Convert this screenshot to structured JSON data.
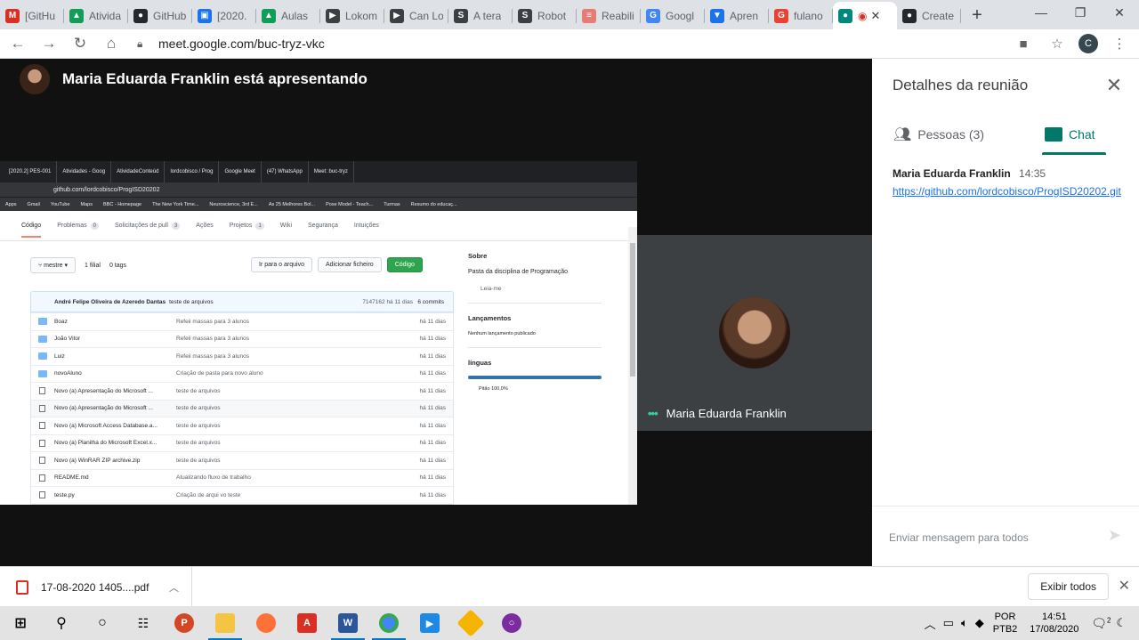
{
  "browser": {
    "tabs": [
      {
        "label": "[GitHu",
        "icon": "gmail-icon",
        "color": "#d93025",
        "glyph": "M"
      },
      {
        "label": "Ativida",
        "icon": "drive-icon",
        "color": "#0f9d58",
        "glyph": "▲"
      },
      {
        "label": "GitHub",
        "icon": "github-icon",
        "color": "#24292e",
        "glyph": "●"
      },
      {
        "label": "[2020.",
        "icon": "classroom-icon",
        "color": "#1a73e8",
        "glyph": "▣"
      },
      {
        "label": "Aulas",
        "icon": "drive-icon",
        "color": "#0f9d58",
        "glyph": "▲"
      },
      {
        "label": "Lokom",
        "icon": "bookmark-icon",
        "color": "#3c4043",
        "glyph": "▶"
      },
      {
        "label": "Can Lo",
        "icon": "bookmark-icon",
        "color": "#3c4043",
        "glyph": "▶"
      },
      {
        "label": "A tera",
        "icon": "scholar-icon",
        "color": "#3c4043",
        "glyph": "S"
      },
      {
        "label": "Robot",
        "icon": "scholar-icon",
        "color": "#3c4043",
        "glyph": "S"
      },
      {
        "label": "Reabili",
        "icon": "site-icon",
        "color": "#e67c73",
        "glyph": "≡"
      },
      {
        "label": "Googl",
        "icon": "translate-icon",
        "color": "#4285f4",
        "glyph": "G"
      },
      {
        "label": "Apren",
        "icon": "site-icon",
        "color": "#1a73e8",
        "glyph": "▼"
      },
      {
        "label": "fulano",
        "icon": "google-icon",
        "color": "#ea4335",
        "glyph": "G"
      },
      {
        "label": "",
        "icon": "meet-icon",
        "color": "#00897b",
        "glyph": "●",
        "active": true
      },
      {
        "label": "Create",
        "icon": "github-icon",
        "color": "#24292e",
        "glyph": "●"
      }
    ],
    "new_tab": "+",
    "url": "meet.google.com/buc-tryz-vkc",
    "profile_initial": "C"
  },
  "meet": {
    "presenting_title": "Maria Eduarda Franklin está apresentando",
    "participant_name": "Maria Eduarda Franklin",
    "panel": {
      "title": "Detalhes da reunião",
      "people_tab": "Pessoas (3)",
      "chat_tab": "Chat",
      "messages": [
        {
          "sender": "Maria Eduarda Franklin",
          "time": "14:35",
          "text": "https://github.com/lordcobisco/ProgISD20202.git"
        }
      ],
      "composer_placeholder": "Enviar mensagem para todos"
    }
  },
  "shared_screen": {
    "tabs": [
      "[2020.2] PES-001",
      "Atividades - Goog",
      "AtividadeConteúd",
      "lordcobisco / Prog",
      "Google Meet",
      "(47) WhatsApp",
      "Meet: buc-tryz"
    ],
    "url": "github.com/lordcobisco/ProgISD20202",
    "bookmarks": [
      "Apps",
      "Gmail",
      "YouTube",
      "Maps",
      "BBC - Homepage",
      "The New York Time...",
      "Neuroscience, 3rd E...",
      "As 25 Melhores Bol...",
      "Pose Model - Teach...",
      "Turmas",
      "Resumo do educaç..."
    ],
    "repo_nav": [
      "Código",
      "Problemas",
      "Solicitações de pull",
      "Ações",
      "Projetos",
      "Wiki",
      "Segurança",
      "Intuições"
    ],
    "repo_nav_counts": {
      "problemas": "0",
      "pull": "3",
      "projetos": "1"
    },
    "branch": "mestre",
    "branch_count": "1 filial",
    "tags": "0 tags",
    "buttons": {
      "goto_file": "Ir para o arquivo",
      "add_file": "Adicionar ficheiro",
      "code": "Código"
    },
    "last_commit": {
      "author": "André Felipe Oliveira de Azeredo Dantas",
      "message": "teste de arquivos",
      "hash": "7147162",
      "age": "há 11 dias",
      "commits": "6 commits"
    },
    "files": [
      {
        "name": "Boaz",
        "type": "dir",
        "message": "Refeii massas para 3 alunos",
        "age": "há 11 dias"
      },
      {
        "name": "João Vitor",
        "type": "dir",
        "message": "Refeii massas para 3 alunos",
        "age": "há 11 dias"
      },
      {
        "name": "Luiz",
        "type": "dir",
        "message": "Refeii massas para 3 alunos",
        "age": "há 11 dias"
      },
      {
        "name": "novoAluno",
        "type": "dir",
        "message": "Criação de pasta para novo aluno",
        "age": "há 11 dias"
      },
      {
        "name": "Novo (a) Apresentação do Microsoft ...",
        "type": "file",
        "message": "teste de arquivos",
        "age": "há 11 dias"
      },
      {
        "name": "Novo (a) Apresentação do Microsoft ...",
        "type": "file",
        "message": "teste de arquivos",
        "age": "há 11 dias"
      },
      {
        "name": "Novo (a) Microsoft Access Database.a...",
        "type": "file",
        "message": "teste de arquivos",
        "age": "há 11 dias"
      },
      {
        "name": "Novo (a) Planilha do Microsoft Excel.x...",
        "type": "file",
        "message": "teste de arquivos",
        "age": "há 11 dias"
      },
      {
        "name": "Novo (a) WinRAR ZIP archive.zip",
        "type": "file",
        "message": "teste de arquivos",
        "age": "há 11 dias"
      },
      {
        "name": "README.md",
        "type": "file",
        "message": "Atualizando fluxo de trabalho",
        "age": "há 11 dias"
      },
      {
        "name": "teste.py",
        "type": "file",
        "message": "Criação de arqui vo teste",
        "age": "há 11 dias"
      }
    ],
    "about": {
      "title": "Sobre",
      "description": "Pasta da disciplina de Programação",
      "readme": "Leia-me"
    },
    "releases": {
      "title": "Lançamentos",
      "text": "Nenhum lançamento publicado"
    },
    "languages": {
      "title": "línguas",
      "entry": "Pitão 100,0%"
    }
  },
  "downloads": {
    "file": "17-08-2020 1405....pdf",
    "show_all": "Exibir todos"
  },
  "taskbar": {
    "lang_top": "POR",
    "lang_bottom": "PTB2",
    "time": "14:51",
    "date": "17/08/2020",
    "notifications": "2"
  }
}
